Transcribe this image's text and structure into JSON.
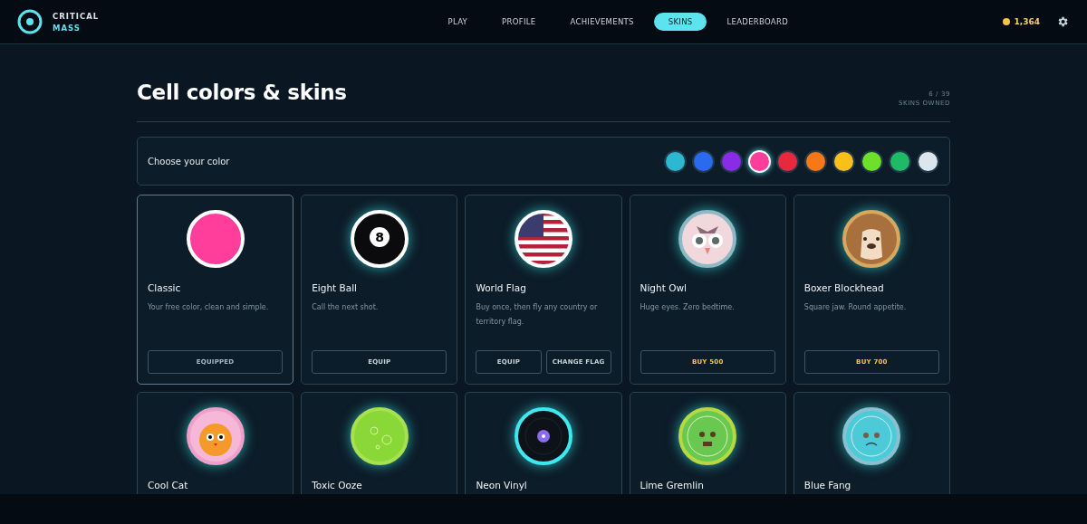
{
  "brand": {
    "line_1": "CRITICAL",
    "line_2": "MASS"
  },
  "nav": [
    {
      "label": "PLAY",
      "selected": false
    },
    {
      "label": "PROFILE",
      "selected": false
    },
    {
      "label": "ACHIEVEMENTS",
      "selected": false
    },
    {
      "label": "SKINS",
      "selected": true
    },
    {
      "label": "LEADERBOARD",
      "selected": false
    }
  ],
  "coins": "1,364",
  "page_title": "Cell colors & skins",
  "owned": {
    "count": "6 / 39",
    "label": "SKINS OWNED"
  },
  "color_picker": {
    "label": "Choose your color",
    "colors": [
      {
        "color": "#2bb8d0",
        "selected": false
      },
      {
        "color": "#2a6af0",
        "selected": false
      },
      {
        "color": "#8a2be8",
        "selected": false
      },
      {
        "color": "#ff3d9a",
        "selected": true
      },
      {
        "color": "#e8283c",
        "selected": false
      },
      {
        "color": "#f87818",
        "selected": false
      },
      {
        "color": "#fbbf1a",
        "selected": false
      },
      {
        "color": "#6ee02a",
        "selected": false
      },
      {
        "color": "#1fba68",
        "selected": false
      },
      {
        "color": "#dde6ee",
        "selected": false
      }
    ]
  },
  "skins": [
    {
      "name": "Classic",
      "description": "Your free color, clean and simple.",
      "kind": "solid",
      "selected": true,
      "buttons": [
        {
          "label": "EQUIPPED",
          "kind": "equipped"
        }
      ]
    },
    {
      "name": "Eight Ball",
      "description": "Call the next shot.",
      "kind": "eight-ball",
      "art_text": "8",
      "selected": false,
      "buttons": [
        {
          "label": "EQUIP",
          "kind": "equip"
        }
      ]
    },
    {
      "name": "World Flag",
      "description": "Buy once, then fly any country or territory flag.",
      "kind": "flag",
      "selected": false,
      "buttons": [
        {
          "label": "EQUIP",
          "kind": "equip"
        },
        {
          "label": "CHANGE FLAG",
          "kind": "equip"
        }
      ]
    },
    {
      "name": "Night Owl",
      "description": "Huge eyes. Zero bedtime.",
      "kind": "owl",
      "selected": false,
      "buttons": [
        {
          "label": "BUY 500",
          "kind": "buy"
        }
      ]
    },
    {
      "name": "Boxer Blockhead",
      "description": "Square jaw. Round appetite.",
      "kind": "dog",
      "selected": false,
      "buttons": [
        {
          "label": "BUY 700",
          "kind": "buy"
        }
      ]
    },
    {
      "name": "Cool Cat",
      "kind": "cat",
      "selected": false
    },
    {
      "name": "Toxic Ooze",
      "kind": "ooze",
      "selected": false
    },
    {
      "name": "Neon Vinyl",
      "kind": "vinyl",
      "selected": false
    },
    {
      "name": "Lime Gremlin",
      "kind": "gremlin",
      "selected": false
    },
    {
      "name": "Blue Fang",
      "kind": "fang",
      "selected": false
    }
  ]
}
